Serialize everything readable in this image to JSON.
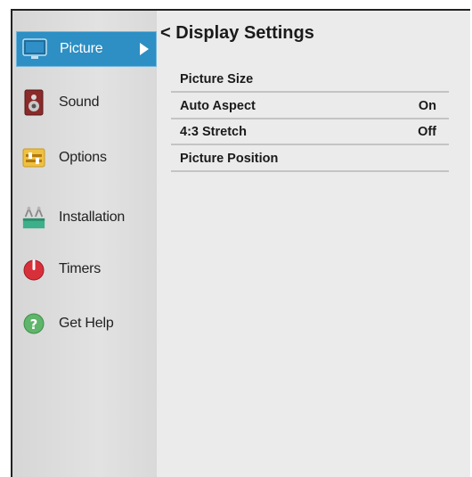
{
  "sidebar": {
    "items": [
      {
        "label": "Picture",
        "icon": "tv-icon",
        "selected": true
      },
      {
        "label": "Sound",
        "icon": "speaker-icon",
        "selected": false
      },
      {
        "label": "Options",
        "icon": "options-icon",
        "selected": false
      },
      {
        "label": "Installation",
        "icon": "installation-icon",
        "selected": false
      },
      {
        "label": "Timers",
        "icon": "timer-icon",
        "selected": false
      },
      {
        "label": "Get Help",
        "icon": "help-icon",
        "selected": false
      }
    ]
  },
  "panel": {
    "back_glyph": "<",
    "title": "Display Settings",
    "rows": [
      {
        "label": "Picture Size",
        "value": ""
      },
      {
        "label": "Auto Aspect",
        "value": "On"
      },
      {
        "label": "4:3 Stretch",
        "value": "Off"
      },
      {
        "label": "Picture Position",
        "value": ""
      }
    ]
  },
  "colors": {
    "selection": "#2d8fc4",
    "sidebar_bg": "#dcdcdc",
    "panel_bg": "#ebebeb"
  }
}
